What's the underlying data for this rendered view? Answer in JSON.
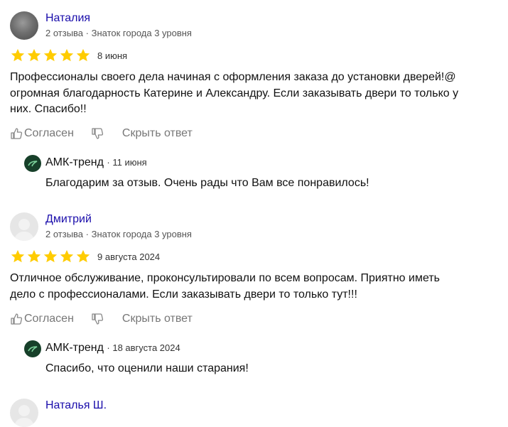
{
  "star_color": "#ffcc00",
  "action_labels": {
    "like": "Согласен",
    "hide_reply": "Скрыть ответ"
  },
  "reviews": [
    {
      "author": "Наталия",
      "meta": "2 отзыва · Знаток города 3 уровня",
      "rating": 5,
      "date": "8 июня",
      "lines": [
        "Профессионалы своего дела начиная с оформления заказа до установки дверей!@",
        "огромная благодарность Катерине и Александру. Если заказывать двери то только у",
        "них. Спасибо!!"
      ],
      "reply": {
        "business": "АМК-тренд",
        "date": "· 11 июня",
        "text": "Благодарим за отзыв. Очень рады что Вам все понравилось!"
      }
    },
    {
      "author": "Дмитрий",
      "meta": "2 отзыва · Знаток города 3 уровня",
      "rating": 5,
      "date": "9 августа 2024",
      "lines": [
        "Отличное обслуживание, проконсультировали по всем вопросам. Приятно иметь",
        "дело с профессионалами. Если заказывать двери то только тут!!!"
      ],
      "reply": {
        "business": "АМК-тренд",
        "date": "· 18 августа 2024",
        "text": "Спасибо, что оценили наши старания!"
      }
    },
    {
      "author": "Наталья Ш."
    }
  ]
}
